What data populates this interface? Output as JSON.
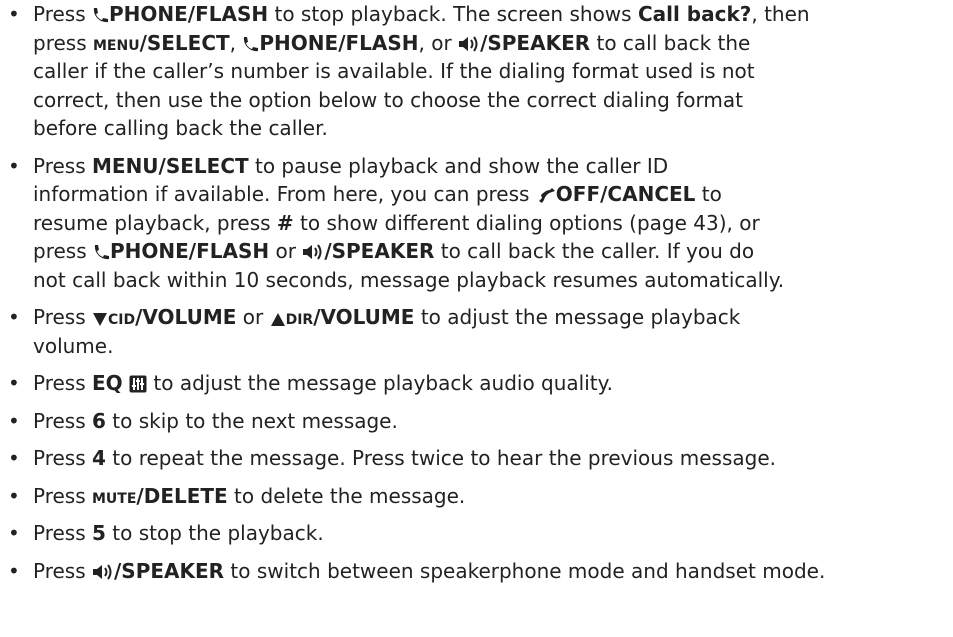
{
  "keys": {
    "phone_flash": "PHONE/FLASH",
    "menu_select_sc": "menu/SELECT",
    "menu_select": "MENU/SELECT",
    "speaker": "/SPEAKER",
    "off_cancel": "OFF/CANCEL",
    "hash": "#",
    "cid_sc": "cid",
    "dir_sc": "dir",
    "volume": "/VOLUME",
    "eq": "EQ",
    "mute_sc": "mute",
    "delete": "/DELETE",
    "six": "6",
    "four": "4",
    "five": "5"
  },
  "items": {
    "i1": {
      "t1": "Press ",
      "t2": " to stop playback. The screen shows ",
      "callback": "Call back?",
      "t3": ", then",
      "t4": "press ",
      "t5": ", ",
      "t6": ", or ",
      "t7": " to call back the",
      "l3": "caller if the caller’s number is available. If the dialing format used is not",
      "l4": "correct, then use the option below to choose the correct dialing format",
      "l5": "before calling back the caller."
    },
    "i2": {
      "t1": "Press ",
      "t2": " to pause playback and show the caller ID",
      "t3": "information if available. From here, you can press ",
      "t4": " to",
      "t5": "resume playback, press ",
      "t6": " to show different dialing options (page 43), or",
      "t7": "press ",
      "t8": " or ",
      "t9": " to call back the caller. If you do",
      "l5": "not call back within 10 seconds, message playback resumes automatically."
    },
    "i3": {
      "t1": "Press ",
      "t2": " or ",
      "t3": " to adjust the message playback",
      "l2": "volume."
    },
    "i4": {
      "t1": "Press ",
      "t2": " to adjust the message playback audio quality."
    },
    "i5": {
      "t1": "Press ",
      "t2": " to skip to the next message."
    },
    "i6": {
      "t1": "Press ",
      "t2": " to repeat the message. Press twice to hear the previous message."
    },
    "i7": {
      "t1": "Press ",
      "t2": " to delete the message."
    },
    "i8": {
      "t1": "Press ",
      "t2": " to stop the playback."
    },
    "i9": {
      "t1": "Press ",
      "t2": " to switch between speakerphone mode and handset mode."
    }
  },
  "bullet": "•"
}
